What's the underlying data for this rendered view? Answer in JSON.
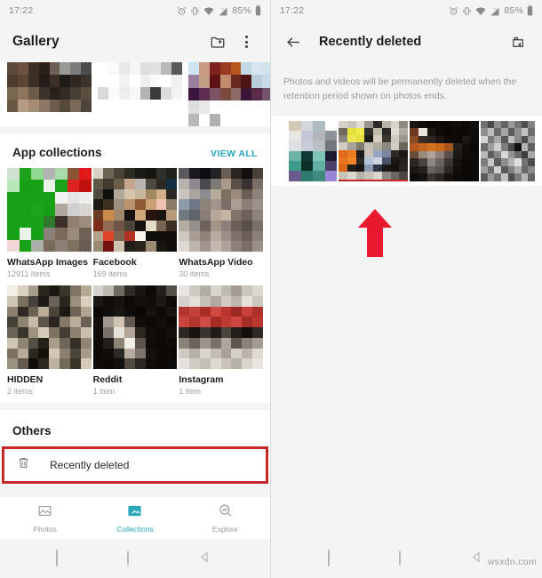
{
  "status_bar": {
    "time": "17:22",
    "battery_pct": "85%",
    "icons": [
      "alarm-icon",
      "vibrate-icon",
      "wifi-icon",
      "signal-no-service-icon",
      "battery-icon"
    ]
  },
  "left_screen": {
    "appbar": {
      "title": "Gallery",
      "actions": [
        "create-folder-icon",
        "overflow-menu-icon"
      ]
    },
    "app_collections": {
      "heading": "App collections",
      "view_all_label": "VIEW ALL",
      "accent_color": "#2aa7b8",
      "items": [
        {
          "name": "WhatsApp Images",
          "count": "12911 items"
        },
        {
          "name": "Facebook",
          "count": "169 items"
        },
        {
          "name": "WhatsApp Video",
          "count": "30 items"
        },
        {
          "name": "HIDDEN",
          "count": "2 items"
        },
        {
          "name": "Reddit",
          "count": "1 item"
        },
        {
          "name": "Instagram",
          "count": "1 item"
        }
      ]
    },
    "others": {
      "heading": "Others",
      "recently_deleted_label": "Recently deleted",
      "highlight_color": "#c62828",
      "icon": "trash-icon"
    },
    "bottom_nav": {
      "items": [
        {
          "label": "Photos",
          "icon": "photo-icon",
          "active": false
        },
        {
          "label": "Collections",
          "icon": "collections-icon",
          "active": true
        },
        {
          "label": "Explore",
          "icon": "explore-search-icon",
          "active": false
        }
      ]
    }
  },
  "right_screen": {
    "appbar": {
      "back_icon": "back-arrow-icon",
      "title": "Recently deleted",
      "action_icon": "empty-trash-icon"
    },
    "notice": "Photos and videos will be permanently deleted when the retention period shown on photos ends.",
    "thumbnail_count": 4,
    "arrow": {
      "icon": "up-arrow-annotation",
      "color": "#e8192c"
    }
  },
  "system_nav": {
    "buttons": [
      "recents-square-icon",
      "home-circle-icon",
      "back-triangle-icon"
    ]
  },
  "watermark": "wsxdn.com"
}
